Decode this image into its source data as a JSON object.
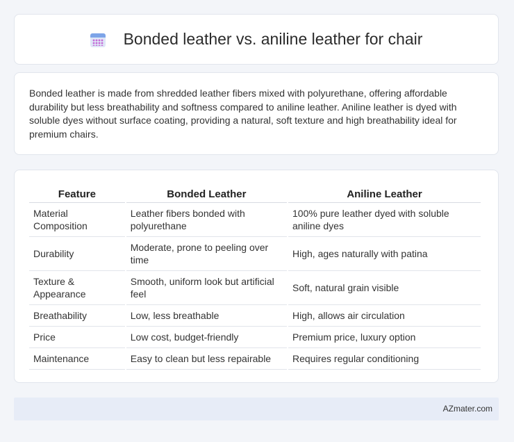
{
  "header": {
    "icon": "calendar-icon",
    "title": "Bonded leather vs. aniline leather for chair"
  },
  "intro": {
    "text": "Bonded leather is made from shredded leather fibers mixed with polyurethane, offering affordable durability but less breathability and softness compared to aniline leather. Aniline leather is dyed with soluble dyes without surface coating, providing a natural, soft texture and high breathability ideal for premium chairs."
  },
  "table": {
    "headers": [
      "Feature",
      "Bonded Leather",
      "Aniline Leather"
    ],
    "rows": [
      [
        "Material Composition",
        "Leather fibers bonded with polyurethane",
        "100% pure leather dyed with soluble aniline dyes"
      ],
      [
        "Durability",
        "Moderate, prone to peeling over time",
        "High, ages naturally with patina"
      ],
      [
        "Texture & Appearance",
        "Smooth, uniform look but artificial feel",
        "Soft, natural grain visible"
      ],
      [
        "Breathability",
        "Low, less breathable",
        "High, allows air circulation"
      ],
      [
        "Price",
        "Low cost, budget-friendly",
        "Premium price, luxury option"
      ],
      [
        "Maintenance",
        "Easy to clean but less repairable",
        "Requires regular conditioning"
      ]
    ]
  },
  "footer": {
    "brand": "AZmater.com"
  }
}
